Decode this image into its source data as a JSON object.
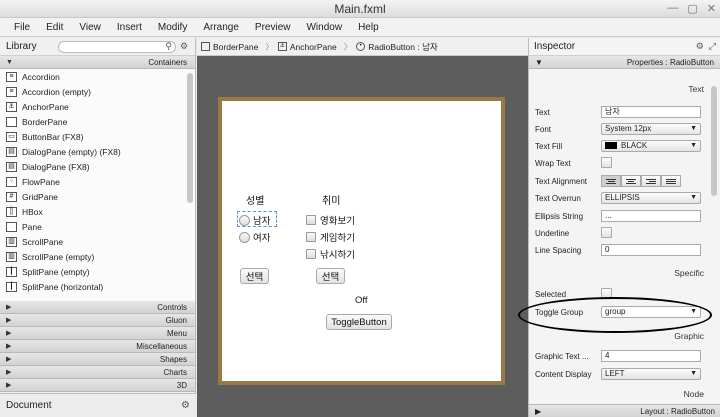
{
  "window": {
    "title": "Main.fxml",
    "min": "—",
    "max": "▢",
    "close": "✕"
  },
  "menu": [
    "File",
    "Edit",
    "View",
    "Insert",
    "Modify",
    "Arrange",
    "Preview",
    "Window",
    "Help"
  ],
  "library": {
    "title": "Library",
    "containers_label": "Containers",
    "items": [
      {
        "label": "Accordion",
        "icon": "accordion-icon"
      },
      {
        "label": "Accordion  (empty)",
        "icon": "accordion-icon"
      },
      {
        "label": "AnchorPane",
        "icon": "anchor-icon"
      },
      {
        "label": "BorderPane",
        "icon": "pane-icon"
      },
      {
        "label": "ButtonBar  (FX8)",
        "icon": "buttonbar-icon"
      },
      {
        "label": "DialogPane  (empty)   (FX8)",
        "icon": "dialog-icon"
      },
      {
        "label": "DialogPane  (FX8)",
        "icon": "dialog-icon"
      },
      {
        "label": "FlowPane",
        "icon": "flow-icon"
      },
      {
        "label": "GridPane",
        "icon": "grid-icon"
      },
      {
        "label": "HBox",
        "icon": "hbox-icon"
      },
      {
        "label": "Pane",
        "icon": "pane-icon"
      },
      {
        "label": "ScrollPane",
        "icon": "scroll-icon"
      },
      {
        "label": "ScrollPane  (empty)",
        "icon": "scroll-icon"
      },
      {
        "label": "SplitPane  (empty)",
        "icon": "split-icon"
      },
      {
        "label": "SplitPane  (horizontal)",
        "icon": "split-icon"
      }
    ],
    "sections": [
      "Controls",
      "Gluon",
      "Menu",
      "Miscellaneous",
      "Shapes",
      "Charts",
      "3D"
    ],
    "document_label": "Document"
  },
  "breadcrumb": [
    {
      "label": "BorderPane",
      "icon": "pane-icon"
    },
    {
      "label": "AnchorPane",
      "icon": "anchor-icon"
    },
    {
      "label": "RadioButton : 남자",
      "icon": "radio-icon"
    }
  ],
  "stage": {
    "gender_label": "성별",
    "hobby_label": "취미",
    "radio_male": "남자",
    "radio_female": "여자",
    "check_movie": "영화보기",
    "check_game": "게임하기",
    "check_fishing": "낚시하기",
    "select_btn_1": "선택",
    "select_btn_2": "선택",
    "off_label": "Off",
    "toggle_btn": "ToggleButton"
  },
  "inspector": {
    "title": "Inspector",
    "properties_bar": "Properties : RadioButton",
    "section_text": "Text",
    "section_specific": "Specific",
    "section_graphic": "Graphic",
    "section_node": "Node",
    "rows": {
      "text": {
        "label": "Text",
        "value": "남자"
      },
      "font": {
        "label": "Font",
        "value": "System 12px"
      },
      "text_fill": {
        "label": "Text Fill",
        "value": "BLACK",
        "swatch": "#000000"
      },
      "wrap_text": {
        "label": "Wrap Text"
      },
      "text_alignment": {
        "label": "Text Alignment"
      },
      "text_overrun": {
        "label": "Text Overrun",
        "value": "ELLIPSIS"
      },
      "ellipsis_string": {
        "label": "Ellipsis String",
        "value": "..."
      },
      "underline": {
        "label": "Underline"
      },
      "line_spacing": {
        "label": "Line Spacing",
        "value": "0"
      },
      "selected": {
        "label": "Selected"
      },
      "toggle_group": {
        "label": "Toggle Group",
        "value": "group"
      },
      "graphic_text_gap": {
        "label": "Graphic Text ...",
        "value": "4"
      },
      "content_display": {
        "label": "Content Display",
        "value": "LEFT"
      }
    },
    "footer": "Layout : RadioButton"
  }
}
